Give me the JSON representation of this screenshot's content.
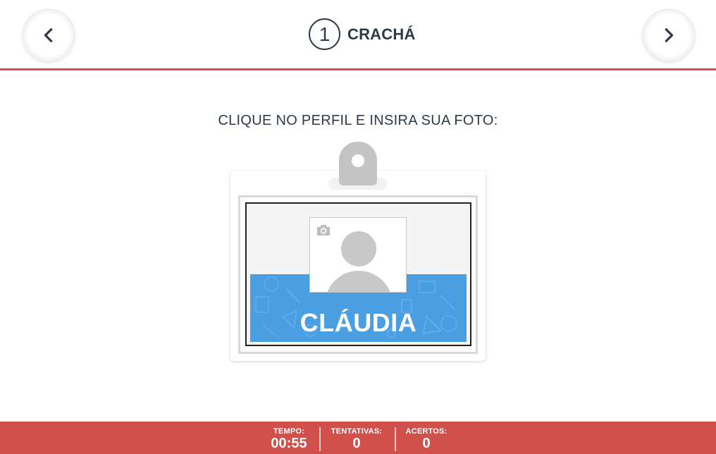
{
  "header": {
    "step_number": "1",
    "title": "CRACHÁ",
    "prev_icon": "chevron-left-icon",
    "next_icon": "chevron-right-icon"
  },
  "instruction": "CLIQUE NO PERFIL E INSIRA SUA FOTO:",
  "badge": {
    "name": "CLÁUDIA",
    "photo_placeholder_icon": "avatar-placeholder-icon",
    "camera_icon": "camera-icon"
  },
  "footer": {
    "time_label": "TEMPO:",
    "time_value": "00:55",
    "tries_label": "TENTATIVAS:",
    "tries_value": "0",
    "hits_label": "ACERTOS:",
    "hits_value": "0"
  },
  "colors": {
    "accent": "#d0504b",
    "badge_band": "#4a9fe3",
    "text": "#2e3a4b"
  }
}
